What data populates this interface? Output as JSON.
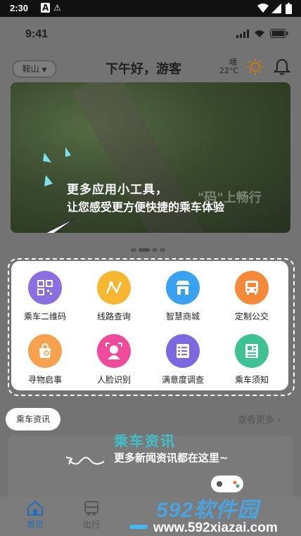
{
  "system_bar": {
    "time": "2:30",
    "a_icon": "A",
    "warning_icon": "⚠"
  },
  "ios_bar": {
    "time": "9:41"
  },
  "header": {
    "city": "鞍山",
    "greeting": "下午好，游客",
    "weather_condition": "晴",
    "temperature": "22°C"
  },
  "banner": {
    "line1": "更多应用小工具，",
    "line2": "让您感受更方便快捷的乘车体验",
    "background_text": "\"码\"上畅行"
  },
  "services": [
    {
      "label": "乘车二维码",
      "icon": "qr-code-icon",
      "color": "#8b6fe0"
    },
    {
      "label": "线路查询",
      "icon": "map-route-icon",
      "color": "#f7b733"
    },
    {
      "label": "智慧商城",
      "icon": "shop-icon",
      "color": "#3aa0f0"
    },
    {
      "label": "定制公交",
      "icon": "bus-icon",
      "color": "#f5893a"
    },
    {
      "label": "寻物启事",
      "icon": "bag-search-icon",
      "color": "#f7a04e"
    },
    {
      "label": "人脸识别",
      "icon": "face-scan-icon",
      "color": "#f04b9a"
    },
    {
      "label": "满意度调查",
      "icon": "survey-icon",
      "color": "#7d68e0"
    },
    {
      "label": "乘车须知",
      "icon": "notice-icon",
      "color": "#3fc293"
    }
  ],
  "news": {
    "tag": "乘车资讯",
    "more": "查看更多",
    "title": "乘车资讯",
    "subtitle": "更多新闻资讯都在这里~"
  },
  "tabs": [
    {
      "label": "首页",
      "active": true
    },
    {
      "label": "出行",
      "active": false
    }
  ],
  "watermark": {
    "brand": "592软件园",
    "url": "www.592xiazai.com"
  }
}
